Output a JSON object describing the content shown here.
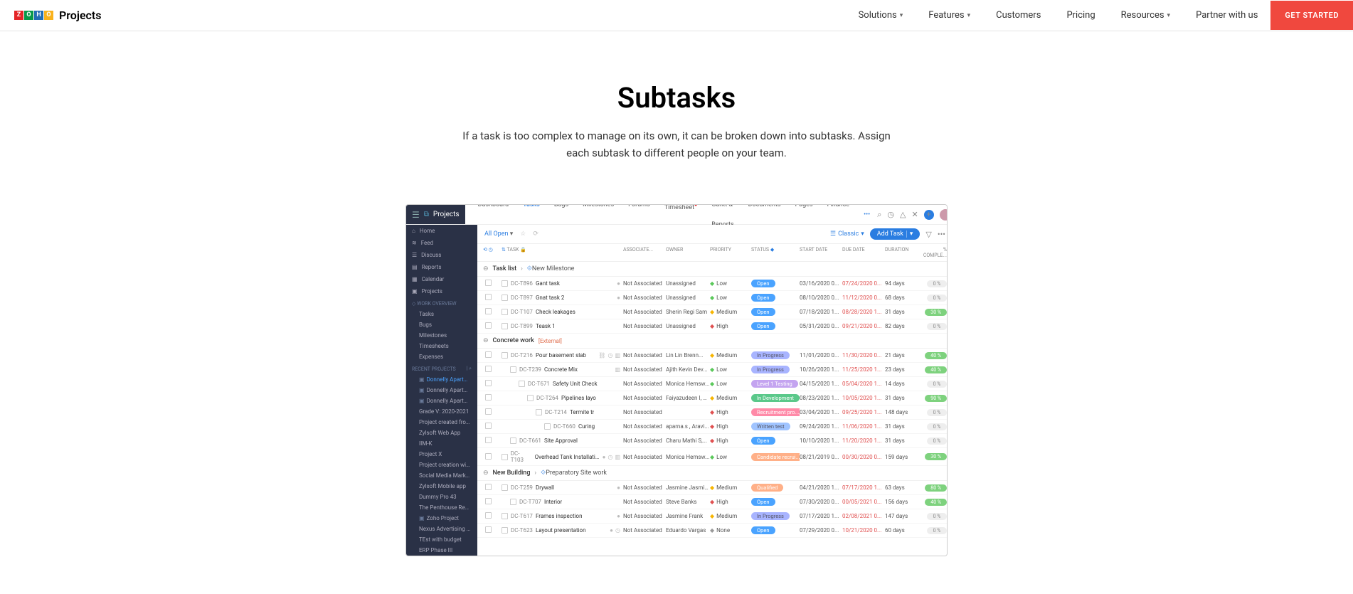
{
  "topnav": {
    "product": "Projects",
    "items": [
      "Solutions",
      "Features",
      "Customers",
      "Pricing",
      "Resources",
      "Partner with us"
    ],
    "items_caret": [
      true,
      true,
      false,
      false,
      true,
      false
    ],
    "cta": "GET STARTED"
  },
  "hero": {
    "title": "Subtasks",
    "subtitle": "If a task is too complex to manage on its own, it can be broken down into subtasks. Assign each subtask to different people on your team."
  },
  "app": {
    "brand": "Projects",
    "tabs": [
      "Dashboard",
      "Tasks",
      "Bugs",
      "Milestones",
      "Forums",
      "Timesheet",
      "Gantt & Reports",
      "Documents",
      "Pages",
      "Finance"
    ],
    "active_tab": 1,
    "badge_tab": 5
  },
  "sidebar": {
    "items": [
      {
        "icon": "⌂",
        "label": "Home"
      },
      {
        "icon": "≋",
        "label": "Feed"
      },
      {
        "icon": "☰",
        "label": "Discuss"
      },
      {
        "icon": "▤",
        "label": "Reports"
      },
      {
        "icon": "▦",
        "label": "Calendar"
      },
      {
        "icon": "▣",
        "label": "Projects"
      }
    ],
    "work_section": "WORK OVERVIEW",
    "work_items": [
      "Tasks",
      "Bugs",
      "Milestones",
      "Timesheets",
      "Expenses"
    ],
    "recent_section": "RECENT PROJECTS",
    "recent_items": [
      "Donnelly Apartments C",
      "Donnelly Apartments C",
      "Donnelly Apartments C",
      "Grade V: 2020-2021",
      "Project created from Cl",
      "Zylsoft Web App",
      "IIM-K",
      "Project X",
      "Project creation with li",
      "Social Media Marketing",
      "Zylsoft Mobile app",
      "Dummy Pro 43",
      "The Penthouse Remod",
      "Zoho Project",
      "Nexus Advertising Age",
      "TEst with budget",
      "ERP Phase III"
    ],
    "recent_selected": 0
  },
  "toolbar": {
    "filter": "All Open",
    "classic": "Classic",
    "add_task": "Add Task"
  },
  "columns": [
    "TASK",
    "ASSOCIATE...",
    "OWNER",
    "PRIORITY",
    "STATUS",
    "START DATE",
    "DUE DATE",
    "DURATION",
    "% COMPLE..."
  ],
  "groups": [
    {
      "name": "Task list",
      "milestone": "New Milestone",
      "rows": [
        {
          "id": "DC-T896",
          "name": "Gant task",
          "assoc": "Not Associated",
          "owner": "Unassigned",
          "prio": "Low",
          "status": "Open",
          "start": "03/16/2020 0...",
          "due": "07/24/2020 0...",
          "dur": "94 days",
          "comp": "0 %",
          "icons": [
            "red"
          ],
          "indent": 0
        },
        {
          "id": "DC-T897",
          "name": "Gnat task 2",
          "assoc": "Not Associated",
          "owner": "Unassigned",
          "prio": "Low",
          "status": "Open",
          "start": "08/10/2020 0...",
          "due": "11/12/2020 0...",
          "dur": "68 days",
          "comp": "0 %",
          "icons": [
            "yellow"
          ],
          "indent": 0
        },
        {
          "id": "DC-T107",
          "name": "Check leakages",
          "assoc": "Not Associated",
          "owner": "Sherin Regi Sam",
          "prio": "Medium",
          "status": "Open",
          "start": "07/18/2020 1...",
          "due": "08/28/2020 1...",
          "dur": "31 days",
          "comp": "30 %",
          "comp_green": true,
          "icons": [],
          "indent": 0
        },
        {
          "id": "DC-T899",
          "name": "Teask 1",
          "assoc": "Not Associated",
          "owner": "Unassigned",
          "prio": "High",
          "status": "Open",
          "start": "05/31/2020 0...",
          "due": "09/21/2020 0...",
          "dur": "82 days",
          "comp": "0 %",
          "icons": [],
          "indent": 0
        }
      ]
    },
    {
      "name": "Concrete work",
      "external": "[External]",
      "rows": [
        {
          "id": "DC-T216",
          "name": "Pour basement slab",
          "assoc": "Not Associated",
          "owner": "Lin Lin Brenn...",
          "prio": "Medium",
          "status": "In Progress",
          "start": "11/01/2020 0...",
          "due": "11/30/2020 0...",
          "dur": "21 days",
          "comp": "40 %",
          "comp_green": true,
          "icons": [
            "chain",
            "clock",
            "chart"
          ],
          "indent": 0
        },
        {
          "id": "DC-T239",
          "name": "Concrete Mix",
          "assoc": "Not Associated",
          "owner": "Ajith Kevin Dev...",
          "prio": "Low",
          "status": "In Progress",
          "start": "10/26/2020 1...",
          "due": "11/25/2020 1...",
          "dur": "23 days",
          "comp": "40 %",
          "comp_green": true,
          "icons": [
            "chart"
          ],
          "indent": 1
        },
        {
          "id": "DC-T671",
          "name": "Safety Unit Check",
          "assoc": "Not Associated",
          "owner": "Monica Hemsw...",
          "prio": "Low",
          "status": "Level 1 Testing",
          "start": "04/15/2020 1...",
          "due": "05/04/2020 1...",
          "dur": "14 days",
          "comp": "0 %",
          "icons": [],
          "indent": 2
        },
        {
          "id": "DC-T264",
          "name": "Pipelines layo",
          "assoc": "Not Associated",
          "owner": "Faiyazudeen I, A...",
          "prio": "Medium",
          "status": "In Development",
          "start": "08/23/2020 1...",
          "due": "10/05/2020 1...",
          "dur": "31 days",
          "comp": "90 %",
          "comp_green": true,
          "icons": [],
          "indent": 3
        },
        {
          "id": "DC-T214",
          "name": "Termite tr",
          "assoc": "Not Associated",
          "owner": "",
          "prio": "High",
          "status": "Recruitment pro...",
          "start": "03/04/2020 1...",
          "due": "09/25/2020 1...",
          "dur": "148 days",
          "comp": "0 %",
          "icons": [],
          "indent": 4
        },
        {
          "id": "DC-T660",
          "name": "Curing",
          "assoc": "Not Associated",
          "owner": "aparna.s , Aravi...",
          "prio": "High",
          "status": "Written test",
          "start": "09/24/2020 1...",
          "due": "11/06/2020 1...",
          "dur": "31 days",
          "comp": "0 %",
          "icons": [],
          "indent": 5
        },
        {
          "id": "DC-T661",
          "name": "Site Approval",
          "assoc": "Not Associated",
          "owner": "Charu Mathi S,...",
          "prio": "High",
          "status": "Open",
          "start": "10/10/2020 1...",
          "due": "11/20/2020 1...",
          "dur": "31 days",
          "comp": "0 %",
          "icons": [],
          "indent": 1
        },
        {
          "id": "DC-T103",
          "name": "Overhead Tank Installation",
          "assoc": "Not Associated",
          "owner": "Monica Hemsw...",
          "prio": "Low",
          "status": "Candidate recrui...",
          "start": "08/21/2019 0...",
          "due": "00/30/2020 0...",
          "dur": "159 days",
          "comp": "30 %",
          "comp_green": true,
          "icons": [
            "red",
            "clock",
            "chart"
          ],
          "indent": 0
        }
      ]
    },
    {
      "name": "New Building",
      "milestone": "Preparatory Site work",
      "rows": [
        {
          "id": "DC-T259",
          "name": "Drywall",
          "assoc": "Not Associated",
          "owner": "Jasmine Jasmin...",
          "prio": "Medium",
          "status": "Qualified",
          "start": "04/21/2020 1...",
          "due": "07/17/2020 1...",
          "dur": "63 days",
          "comp": "80 %",
          "comp_green": true,
          "icons": [
            "red"
          ],
          "indent": 0
        },
        {
          "id": "DC-T707",
          "name": "Interior",
          "assoc": "Not Associated",
          "owner": "Steve Banks",
          "prio": "High",
          "status": "Open",
          "start": "07/30/2020 0...",
          "due": "00/05/2021 0...",
          "dur": "156 days",
          "comp": "40 %",
          "comp_green": true,
          "icons": [],
          "indent": 1
        },
        {
          "id": "DC-T617",
          "name": "Frames inspection",
          "assoc": "Not Associated",
          "owner": "Jasmine Frank",
          "prio": "Medium",
          "status": "In Progress",
          "start": "07/17/2020 1...",
          "due": "02/08/2021 0...",
          "dur": "147 days",
          "comp": "0 %",
          "icons": [
            "yellow"
          ],
          "indent": 0
        },
        {
          "id": "DC-T623",
          "name": "Layout presentation",
          "assoc": "Not Associated",
          "owner": "Eduardo Vargas",
          "prio": "None",
          "status": "Open",
          "start": "07/29/2020 0...",
          "due": "10/21/2020 0...",
          "dur": "60 days",
          "comp": "0 %",
          "icons": [
            "red",
            "clock"
          ],
          "indent": 0
        }
      ]
    }
  ]
}
